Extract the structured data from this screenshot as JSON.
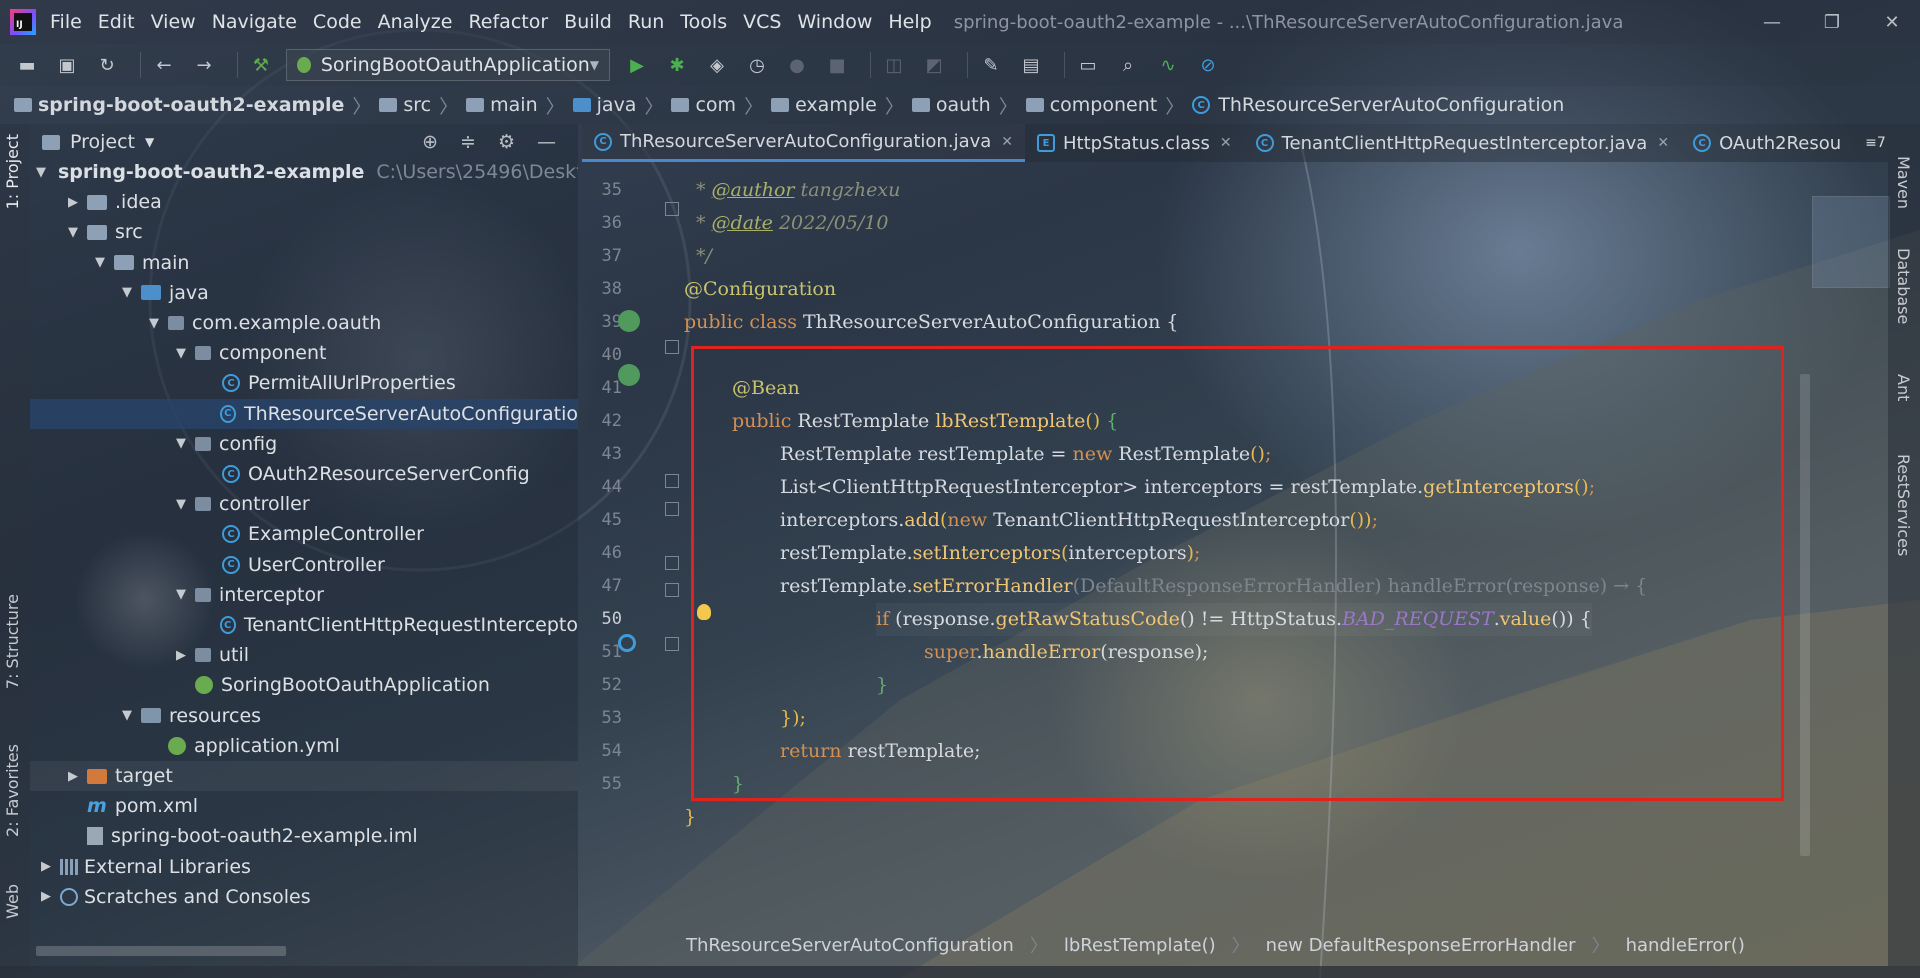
{
  "window": {
    "title": "spring-boot-oauth2-example - ...\\ThResourceServerAutoConfiguration.java",
    "logo_text": "IJ"
  },
  "menu": [
    "File",
    "Edit",
    "View",
    "Navigate",
    "Code",
    "Analyze",
    "Refactor",
    "Build",
    "Run",
    "Tools",
    "VCS",
    "Window",
    "Help"
  ],
  "toolbar": {
    "run_config": "SoringBootOauthApplication"
  },
  "breadcrumb": [
    "spring-boot-oauth2-example",
    "src",
    "main",
    "java",
    "com",
    "example",
    "oauth",
    "component",
    "ThResourceServerAutoConfiguration"
  ],
  "left_strip": {
    "project_tab": "1: Project",
    "structure_tab": "7: Structure",
    "favorites_tab": "2: Favorites",
    "web_tab": "Web"
  },
  "right_strip": {
    "maven": "Maven",
    "database": "Database",
    "ant": "Ant",
    "rest": "RestServices"
  },
  "project": {
    "title": "Project",
    "tree": [
      {
        "label": "spring-boot-oauth2-example",
        "path": "C:\\Users\\25496\\Deskt",
        "indent": 0,
        "arrow": "down",
        "icon": "folder"
      },
      {
        "label": ".idea",
        "indent": 1,
        "arrow": "right",
        "icon": "folder"
      },
      {
        "label": "src",
        "indent": 1,
        "arrow": "down",
        "icon": "folder"
      },
      {
        "label": "main",
        "indent": 2,
        "arrow": "down",
        "icon": "folder"
      },
      {
        "label": "java",
        "indent": 3,
        "arrow": "down",
        "icon": "java"
      },
      {
        "label": "com.example.oauth",
        "indent": 4,
        "arrow": "down",
        "icon": "pkg"
      },
      {
        "label": "component",
        "indent": 5,
        "arrow": "down",
        "icon": "pkg"
      },
      {
        "label": "PermitAllUrlProperties",
        "indent": 6,
        "arrow": "",
        "icon": "class"
      },
      {
        "label": "ThResourceServerAutoConfiguratio",
        "indent": 6,
        "arrow": "",
        "icon": "class",
        "selected": true
      },
      {
        "label": "config",
        "indent": 5,
        "arrow": "down",
        "icon": "pkg"
      },
      {
        "label": "OAuth2ResourceServerConfig",
        "indent": 6,
        "arrow": "",
        "icon": "class"
      },
      {
        "label": "controller",
        "indent": 5,
        "arrow": "down",
        "icon": "pkg"
      },
      {
        "label": "ExampleController",
        "indent": 6,
        "arrow": "",
        "icon": "class"
      },
      {
        "label": "UserController",
        "indent": 6,
        "arrow": "",
        "icon": "class"
      },
      {
        "label": "interceptor",
        "indent": 5,
        "arrow": "down",
        "icon": "pkg"
      },
      {
        "label": "TenantClientHttpRequestIntercepto",
        "indent": 6,
        "arrow": "",
        "icon": "class"
      },
      {
        "label": "util",
        "indent": 5,
        "arrow": "right",
        "icon": "pkg"
      },
      {
        "label": "SoringBootOauthApplication",
        "indent": 5,
        "arrow": "",
        "icon": "spring"
      },
      {
        "label": "resources",
        "indent": 3,
        "arrow": "down",
        "icon": "res"
      },
      {
        "label": "application.yml",
        "indent": 4,
        "arrow": "",
        "icon": "spring"
      },
      {
        "label": "target",
        "indent": 1,
        "arrow": "right",
        "icon": "target",
        "highlight": true
      },
      {
        "label": "pom.xml",
        "indent": 1,
        "arrow": "",
        "icon": "maven"
      },
      {
        "label": "spring-boot-oauth2-example.iml",
        "indent": 1,
        "arrow": "",
        "icon": "iml"
      },
      {
        "label": "External Libraries",
        "indent": 0,
        "arrow": "right",
        "icon": "lib"
      },
      {
        "label": "Scratches and Consoles",
        "indent": 0,
        "arrow": "right",
        "icon": "scratch"
      }
    ]
  },
  "tabs": [
    {
      "label": "ThResourceServerAutoConfiguration.java",
      "active": true
    },
    {
      "label": "HttpStatus.class",
      "active": false
    },
    {
      "label": "TenantClientHttpRequestInterceptor.java",
      "active": false
    },
    {
      "label": "OAuth2Resou",
      "active": false
    }
  ],
  "tabs_overflow": "≡7",
  "editor": {
    "line_numbers": [
      "35",
      "36",
      "37",
      "38",
      "39",
      "40",
      "41",
      "42",
      "43",
      "44",
      "45",
      "46",
      "47",
      "50",
      "51",
      "52",
      "53",
      "54",
      "55"
    ],
    "current_line": "50",
    "code": {
      "l35_tag": "@author",
      "l35_text": " tangzhexu",
      "l36_tag": "@date",
      "l36_text": " 2022/05/10",
      "l37": "*/",
      "l38": "@Configuration",
      "l39_kw": "public class ",
      "l39_name": "ThResourceServerAutoConfiguration {",
      "l41": "@Bean",
      "l42_kw": "public ",
      "l42_type": "RestTemplate ",
      "l42_name": "lbRestTemplate",
      "l43_a": "RestTemplate restTemplate = ",
      "l43_kw": "new ",
      "l43_b": "RestTemplate",
      "l44_a": "List<ClientHttpRequestInterceptor> interceptors = restTemplate.",
      "l44_m": "getInterceptors",
      "l45_a": "interceptors.",
      "l45_m": "add",
      "l45_kw": "new ",
      "l45_b": "TenantClientHttpRequestInterceptor",
      "l46_a": "restTemplate.",
      "l46_m": "setInterceptors",
      "l46_b": "interceptors",
      "l47_a": "restTemplate.",
      "l47_m": "setErrorHandler",
      "l47_hint": "(DefaultResponseErrorHandler) handleError(response) → {",
      "l50_kw": "if ",
      "l50_a": "(response.",
      "l50_m": "getRawStatusCode",
      "l50_b": "() != HttpStatus.",
      "l50_static": "BAD_REQUEST",
      "l50_c": ".",
      "l50_m2": "value",
      "l50_d": "()) {",
      "l51_kw": "super",
      "l51_a": ".",
      "l51_m": "handleError",
      "l51_b": "(response);",
      "l52": "}",
      "l53": "});",
      "l54_kw": "return ",
      "l54_a": "restTemplate;",
      "l55": "}",
      "l56": "}"
    }
  },
  "editor_crumbs": [
    "ThResourceServerAutoConfiguration",
    "lbRestTemplate()",
    "new DefaultResponseErrorHandler",
    "handleError()"
  ]
}
